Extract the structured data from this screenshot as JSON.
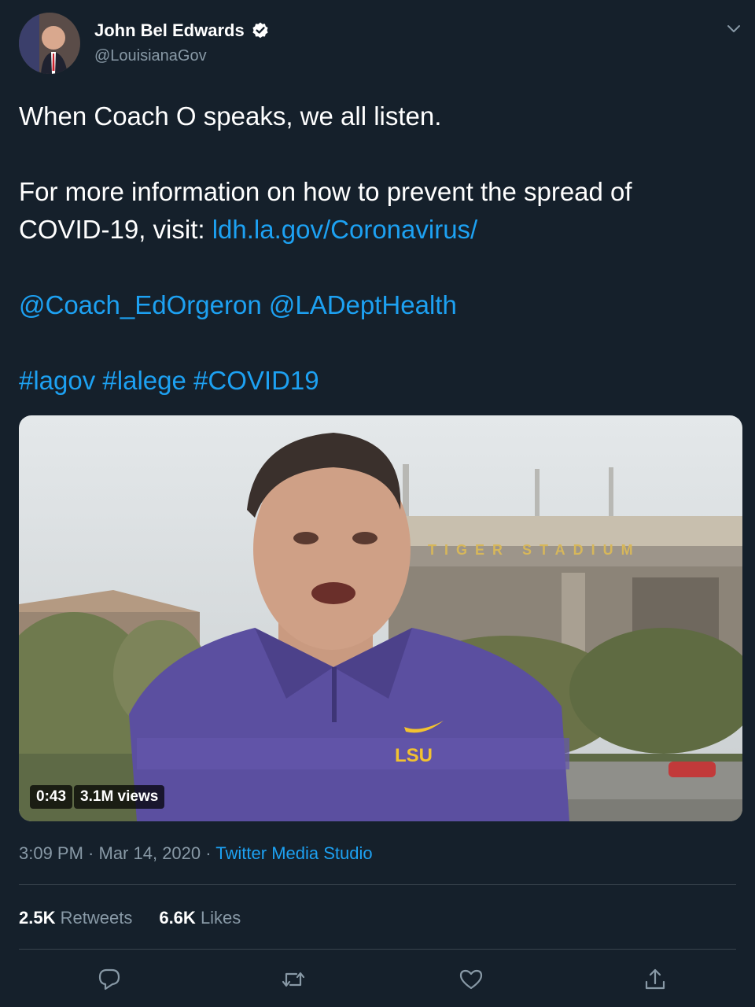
{
  "author": {
    "name": "John Bel Edwards",
    "handle": "@LouisianaGov"
  },
  "tweet": {
    "line1": "When Coach O speaks, we all listen.",
    "line2": "For more information on how to prevent the spread of",
    "line3_prefix": "COVID-19, visit: ",
    "link": "ldh.la.gov/Coronavirus/",
    "mention1": "@Coach_EdOrgeron",
    "mention2": "@LADeptHealth",
    "hashtag1": "#lagov",
    "hashtag2": "#lalege",
    "hashtag3": "#COVID19"
  },
  "video": {
    "duration": "0:43",
    "views": "3.1M views",
    "shirt_logo": "LSU",
    "stadium_sign": "TIGER STADIUM"
  },
  "meta": {
    "time": "3:09 PM",
    "separator": " · ",
    "date": "Mar 14, 2020",
    "source": "Twitter Media Studio"
  },
  "stats": {
    "retweets_count": "2.5K",
    "retweets_label": "Retweets",
    "likes_count": "6.6K",
    "likes_label": "Likes"
  },
  "icons": [
    "verified-icon",
    "chevron-down-icon",
    "reply-icon",
    "retweet-icon",
    "like-icon",
    "share-icon"
  ],
  "colors": {
    "background": "#15202b",
    "link": "#1da1f2",
    "secondary": "#8899a6",
    "lsu_purple": "#5b4fa0",
    "lsu_gold": "#f2c230"
  }
}
